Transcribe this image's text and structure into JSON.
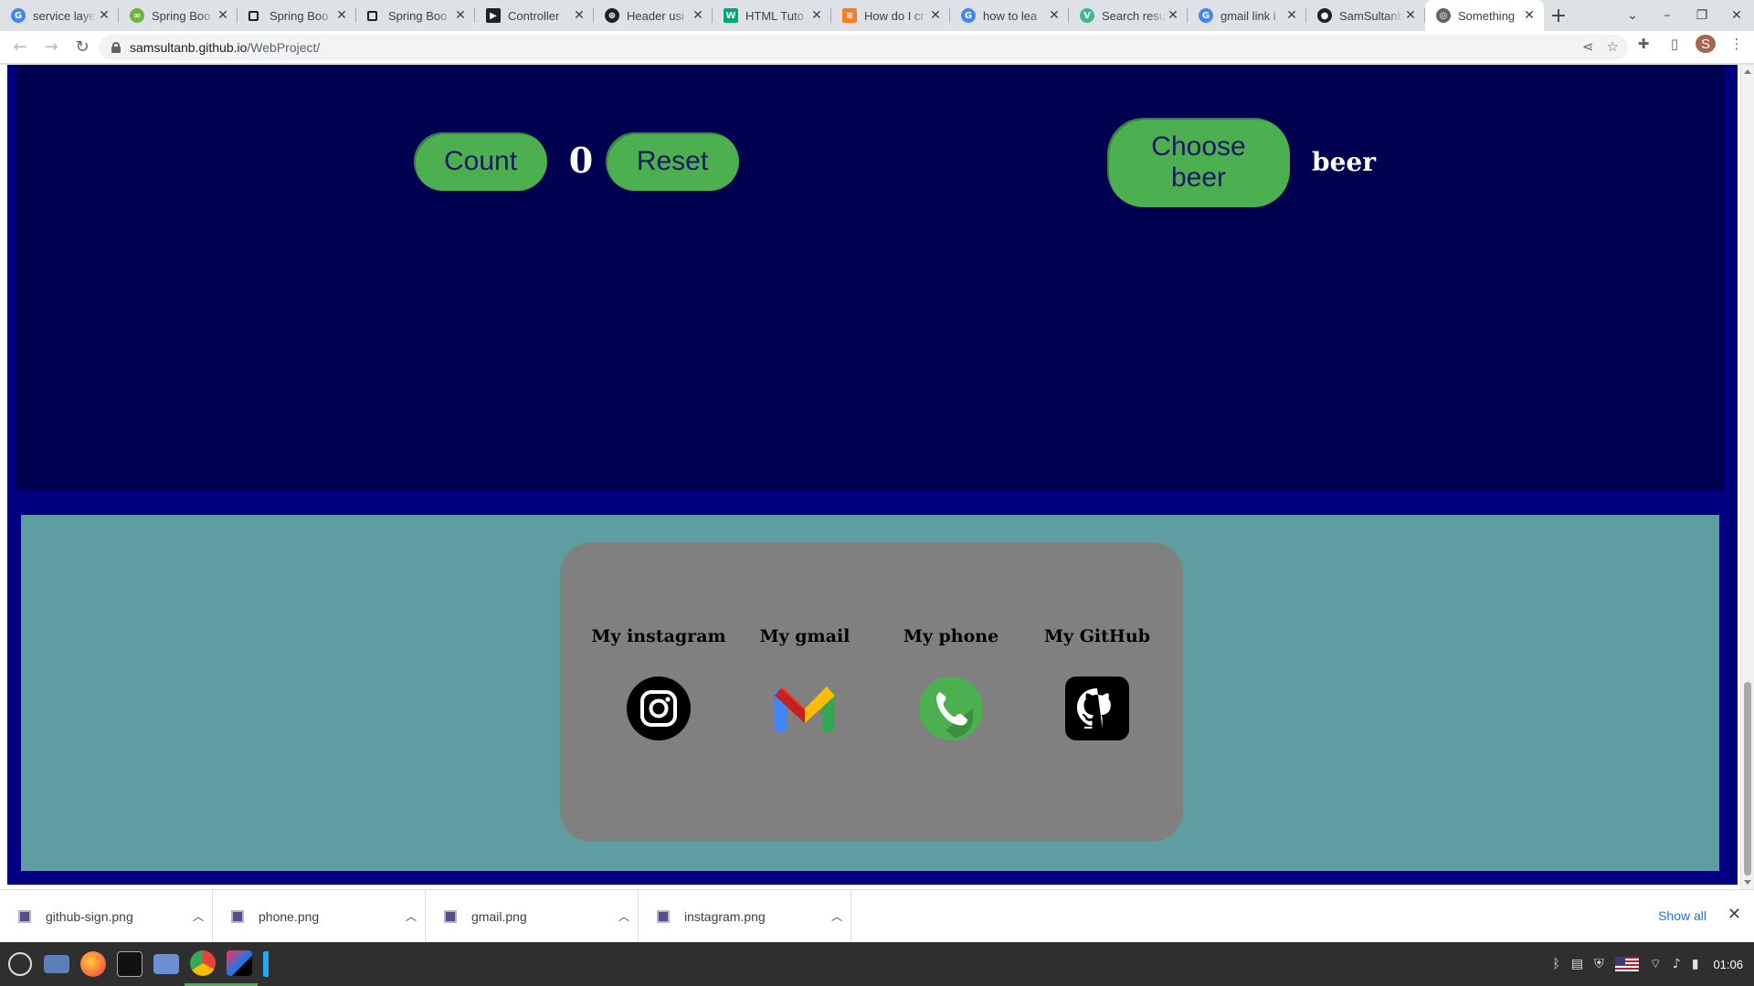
{
  "browser": {
    "tabs": [
      {
        "title": "service laye",
        "favicon": "google-icon",
        "color": "#4285f4",
        "active": false
      },
      {
        "title": "Spring Boo",
        "favicon": "spring-icon",
        "color": "#6db33f",
        "active": false
      },
      {
        "title": "Spring Boo",
        "favicon": "page-icon",
        "color": "#5f6368",
        "active": false
      },
      {
        "title": "Spring Boo",
        "favicon": "page-icon",
        "color": "#5f6368",
        "active": false
      },
      {
        "title": "Controller",
        "favicon": "video-icon",
        "color": "#202124",
        "active": false
      },
      {
        "title": "Header usi",
        "favicon": "chrome-icon",
        "color": "#202124",
        "active": false
      },
      {
        "title": "HTML Tuto",
        "favicon": "w3schools-icon",
        "color": "#04aa6d",
        "active": false
      },
      {
        "title": "How do I cr",
        "favicon": "stackoverflow-icon",
        "color": "#f48024",
        "active": false
      },
      {
        "title": "how to lea",
        "favicon": "google-icon",
        "color": "#4285f4",
        "active": false
      },
      {
        "title": "Search resu",
        "favicon": "vue-icon",
        "color": "#41b883",
        "active": false
      },
      {
        "title": "gmail link i",
        "favicon": "google-icon",
        "color": "#4285f4",
        "active": false
      },
      {
        "title": "SamSultanb",
        "favicon": "github-icon",
        "color": "#202124",
        "active": false
      },
      {
        "title": "Something",
        "favicon": "globe-icon",
        "color": "#5f6368",
        "active": true
      }
    ],
    "url_host": "samsultanb.github.io",
    "url_path": "/WebProject/",
    "profile_initial": "S"
  },
  "page": {
    "count_button": "Count",
    "counter_value": "0",
    "reset_button": "Reset",
    "choose_beer_button": "Choose beer",
    "beer_text": "beer",
    "contacts": [
      {
        "label": "My instagram",
        "icon": "instagram-icon"
      },
      {
        "label": "My gmail",
        "icon": "gmail-icon"
      },
      {
        "label": "My phone",
        "icon": "phone-icon"
      },
      {
        "label": "My GitHub",
        "icon": "github-icon"
      }
    ],
    "colors": {
      "outer": "#000080",
      "panel": "#000050",
      "button": "#4caf50",
      "footer": "#5f9ea0",
      "card": "#808080"
    }
  },
  "downloads": {
    "items": [
      "github-sign.png",
      "phone.png",
      "gmail.png",
      "instagram.png"
    ],
    "show_all": "Show all"
  },
  "taskbar": {
    "clock": "01:06"
  }
}
